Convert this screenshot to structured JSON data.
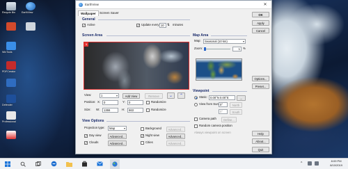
{
  "window": {
    "title": "EarthView",
    "tabs": [
      "Wallpaper",
      "Screen Saver"
    ],
    "side_buttons": [
      "OK",
      "Apply",
      "Cancel",
      "Options...",
      "Preset...",
      "Help",
      "About...",
      "Quit"
    ]
  },
  "general": {
    "title": "General",
    "active_label": "Active",
    "active_checked": true,
    "update_label": "Update every",
    "update_checked": true,
    "update_value": "10",
    "update_unit": "minutes"
  },
  "screen_area": {
    "title": "Screen Area",
    "badge": "1",
    "view_label": "View:",
    "view_value": "1",
    "add_view": "Add View",
    "remove": "Remove",
    "position_label": "Position:",
    "x_label": "X:",
    "x_value": "0",
    "y_label": "Y:",
    "y_value": "0",
    "size_label": "Size:",
    "w_label": "W:",
    "w_value": "1366",
    "h_label": "H:",
    "h_value": "663",
    "randomize1": "Randomize",
    "randomize2": "Randomize"
  },
  "view_options": {
    "title": "View Options",
    "projection_label": "Projection type:",
    "projection_value": "Map",
    "day_view": "Day view",
    "night_view": "Night view",
    "clouds": "Clouds",
    "background": "Background",
    "cities": "Cities",
    "advanced": "Advanced...",
    "day_checked": true,
    "night_checked": true,
    "clouds_checked": true,
    "background_checked": false,
    "cities_checked": false
  },
  "map_area": {
    "title": "Map Area",
    "map_label": "Map:",
    "map_value": "Seasonal (10 km)",
    "zoom_label": "Zoom:",
    "zoom_value": "1",
    "zoom_unit": "%"
  },
  "viewpoint": {
    "title": "Viewpoint",
    "static_label": "Static:",
    "static_value": "0.00°N 0.00°E",
    "sun_label": "View from Sun +",
    "sun_value": "0°",
    "north": "North",
    "south": "South",
    "sun_value2": "0°",
    "camera_path": "Camera path",
    "define": "Define...",
    "random_camera": "Random camera position",
    "note": "Always viewpoint on screen"
  },
  "desktop_icons": [
    "Recycle Bin",
    "EarthView",
    "",
    "",
    "WinTools",
    "PDFCreator",
    "",
    "",
    "",
    "Defender",
    "",
    "Professional",
    "",
    ""
  ],
  "taskbar": {
    "time": "8:09 PM",
    "date": "8/10/2019"
  },
  "colors": {
    "accent": "#e0302f",
    "section_title": "#1a2b6b"
  }
}
